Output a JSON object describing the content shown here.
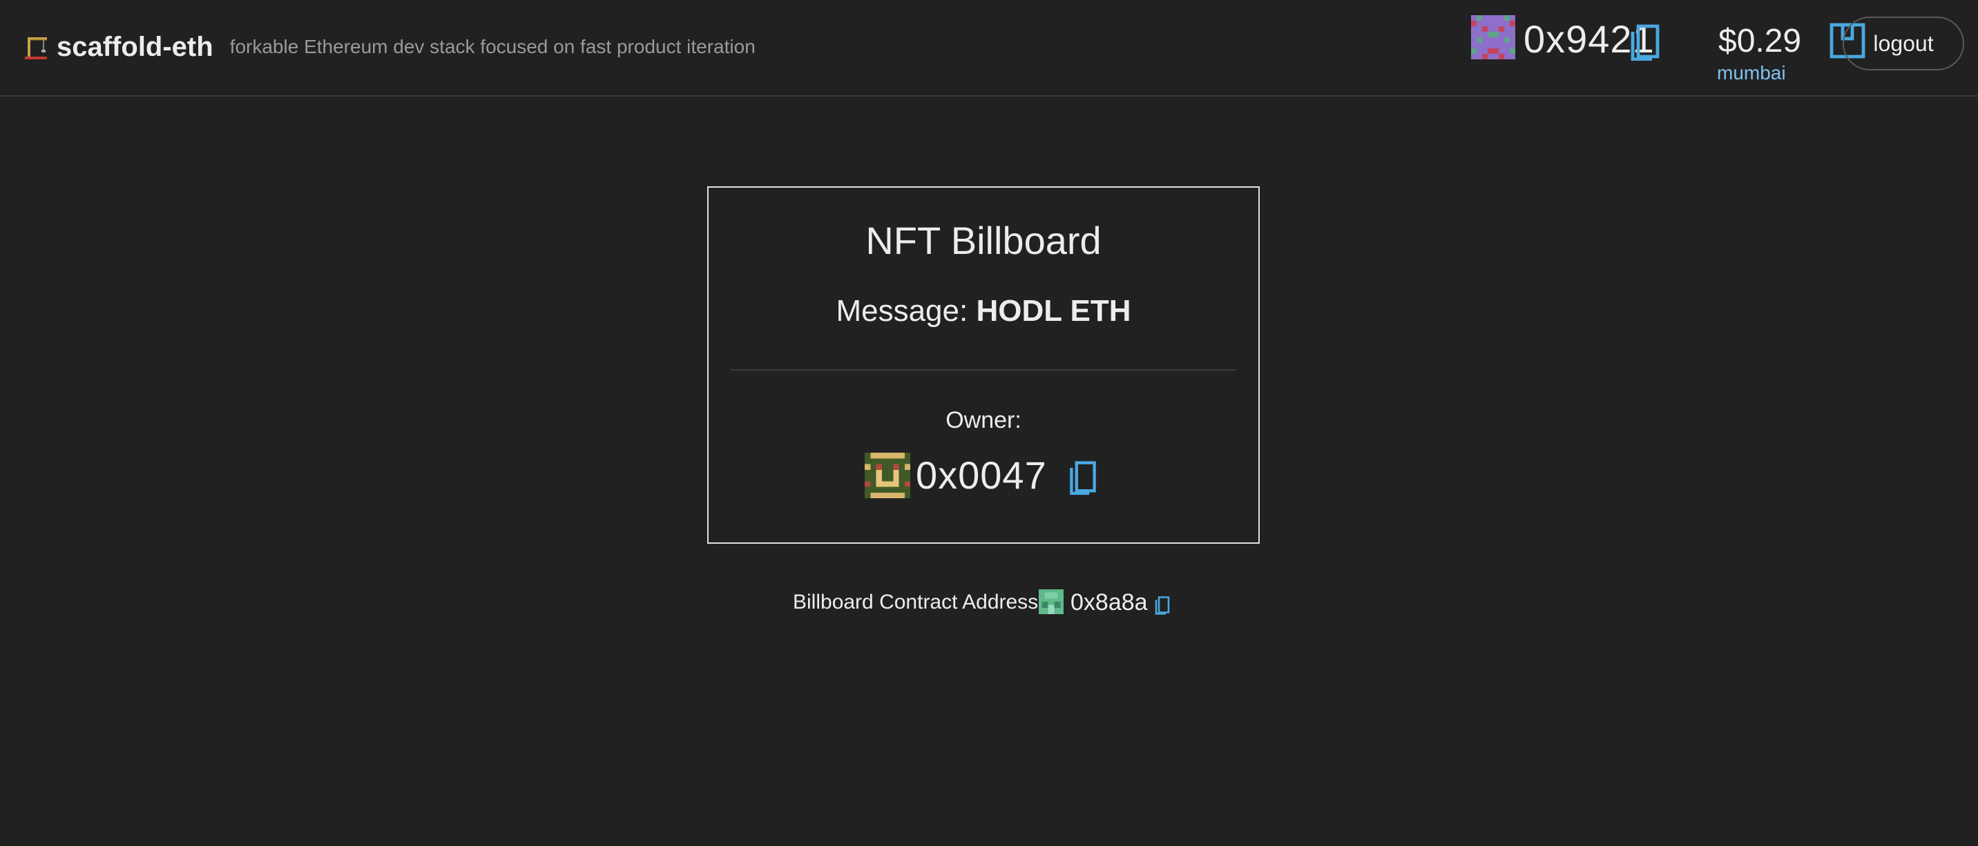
{
  "header": {
    "title": "scaffold-eth",
    "subtitle": "forkable Ethereum dev stack focused on fast product iteration",
    "brand_icon": "crane-icon"
  },
  "account": {
    "address_short": "0x9421",
    "balance": "$0.29",
    "network": "mumbai",
    "logout_label": "logout",
    "copy_icon": "copy-icon",
    "wallet_icon": "wallet-icon"
  },
  "billboard": {
    "title": "NFT Billboard",
    "message_label": "Message:",
    "message_value": "HODL ETH",
    "owner_label": "Owner:",
    "owner_address": "0x0047"
  },
  "contract": {
    "label": "Billboard Contract Address:",
    "address": "0x8a8a"
  },
  "colors": {
    "background": "#212121",
    "accent": "#4aa8e0",
    "network": "#7ec3f0",
    "border": "#e0e0e0"
  }
}
